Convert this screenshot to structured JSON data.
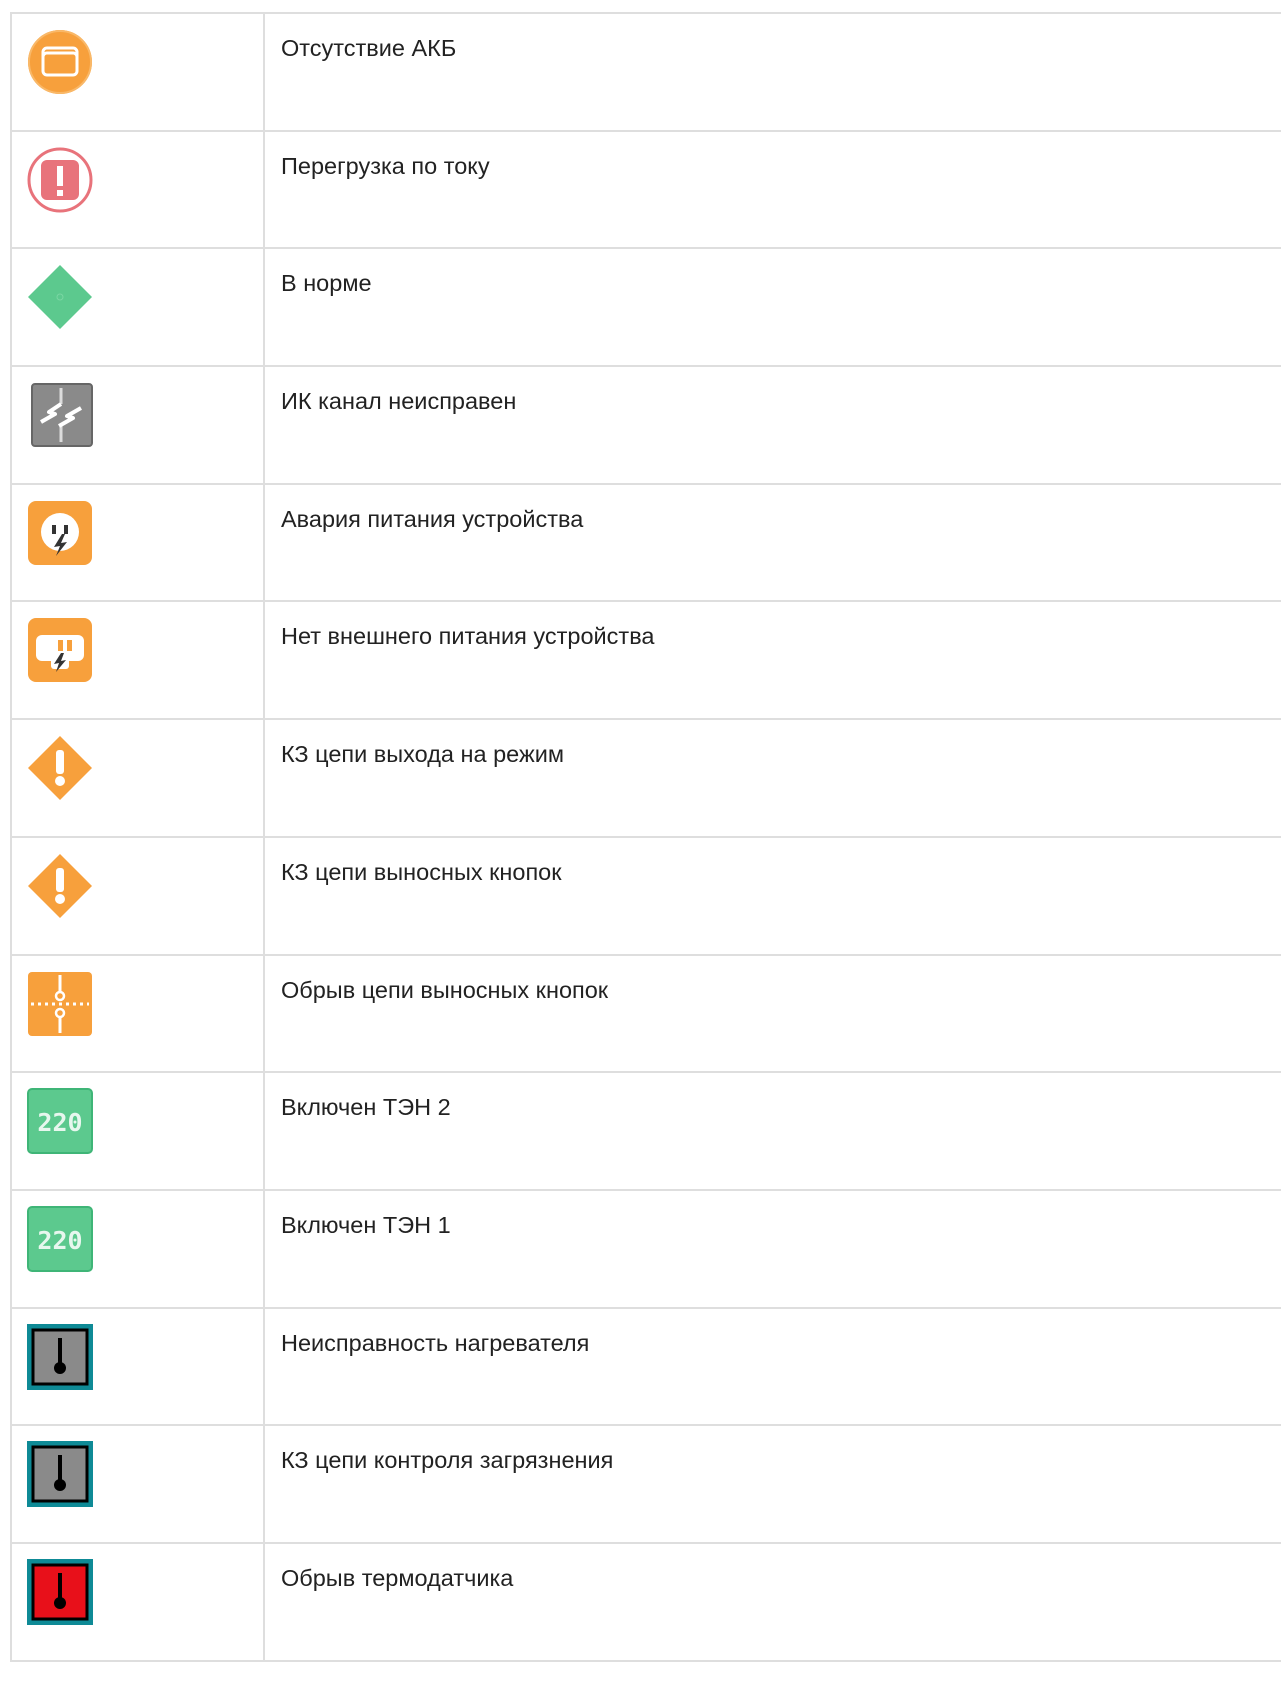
{
  "rows": [
    {
      "icon": "battery-missing-icon",
      "label": "Отсутствие АКБ"
    },
    {
      "icon": "current-overload-icon",
      "label": "Перегрузка по току"
    },
    {
      "icon": "normal-status-icon",
      "label": "В норме"
    },
    {
      "icon": "ir-channel-fault-icon",
      "label": "ИК канал неисправен"
    },
    {
      "icon": "device-power-failure-icon",
      "label": "Авария питания устройства"
    },
    {
      "icon": "no-external-power-icon",
      "label": "Нет внешнего питания устройства"
    },
    {
      "icon": "short-circuit-mode-output-icon",
      "label": "КЗ цепи выхода на режим"
    },
    {
      "icon": "short-circuit-remote-buttons-icon",
      "label": "КЗ цепи выносных кнопок"
    },
    {
      "icon": "open-circuit-remote-buttons-icon",
      "label": "Обрыв цепи выносных кнопок"
    },
    {
      "icon": "heater-2-on-icon",
      "icon_text": "220",
      "label": "Включен ТЭН 2"
    },
    {
      "icon": "heater-1-on-icon",
      "icon_text": "220",
      "label": "Включен ТЭН 1"
    },
    {
      "icon": "heater-fault-icon",
      "label": "Неисправность нагревателя"
    },
    {
      "icon": "contamination-control-short-icon",
      "label": "КЗ цепи контроля загрязнения"
    },
    {
      "icon": "thermosensor-break-icon",
      "label": "Обрыв термодатчика"
    }
  ],
  "colors": {
    "orange": "#f7a03c",
    "red": "#e8737b",
    "green": "#5cc98e",
    "gray": "#8a8a8a",
    "teal_frame": "#0e8a96",
    "alarm_red": "#e8101a",
    "border": "#dedede",
    "text": "#222222"
  }
}
